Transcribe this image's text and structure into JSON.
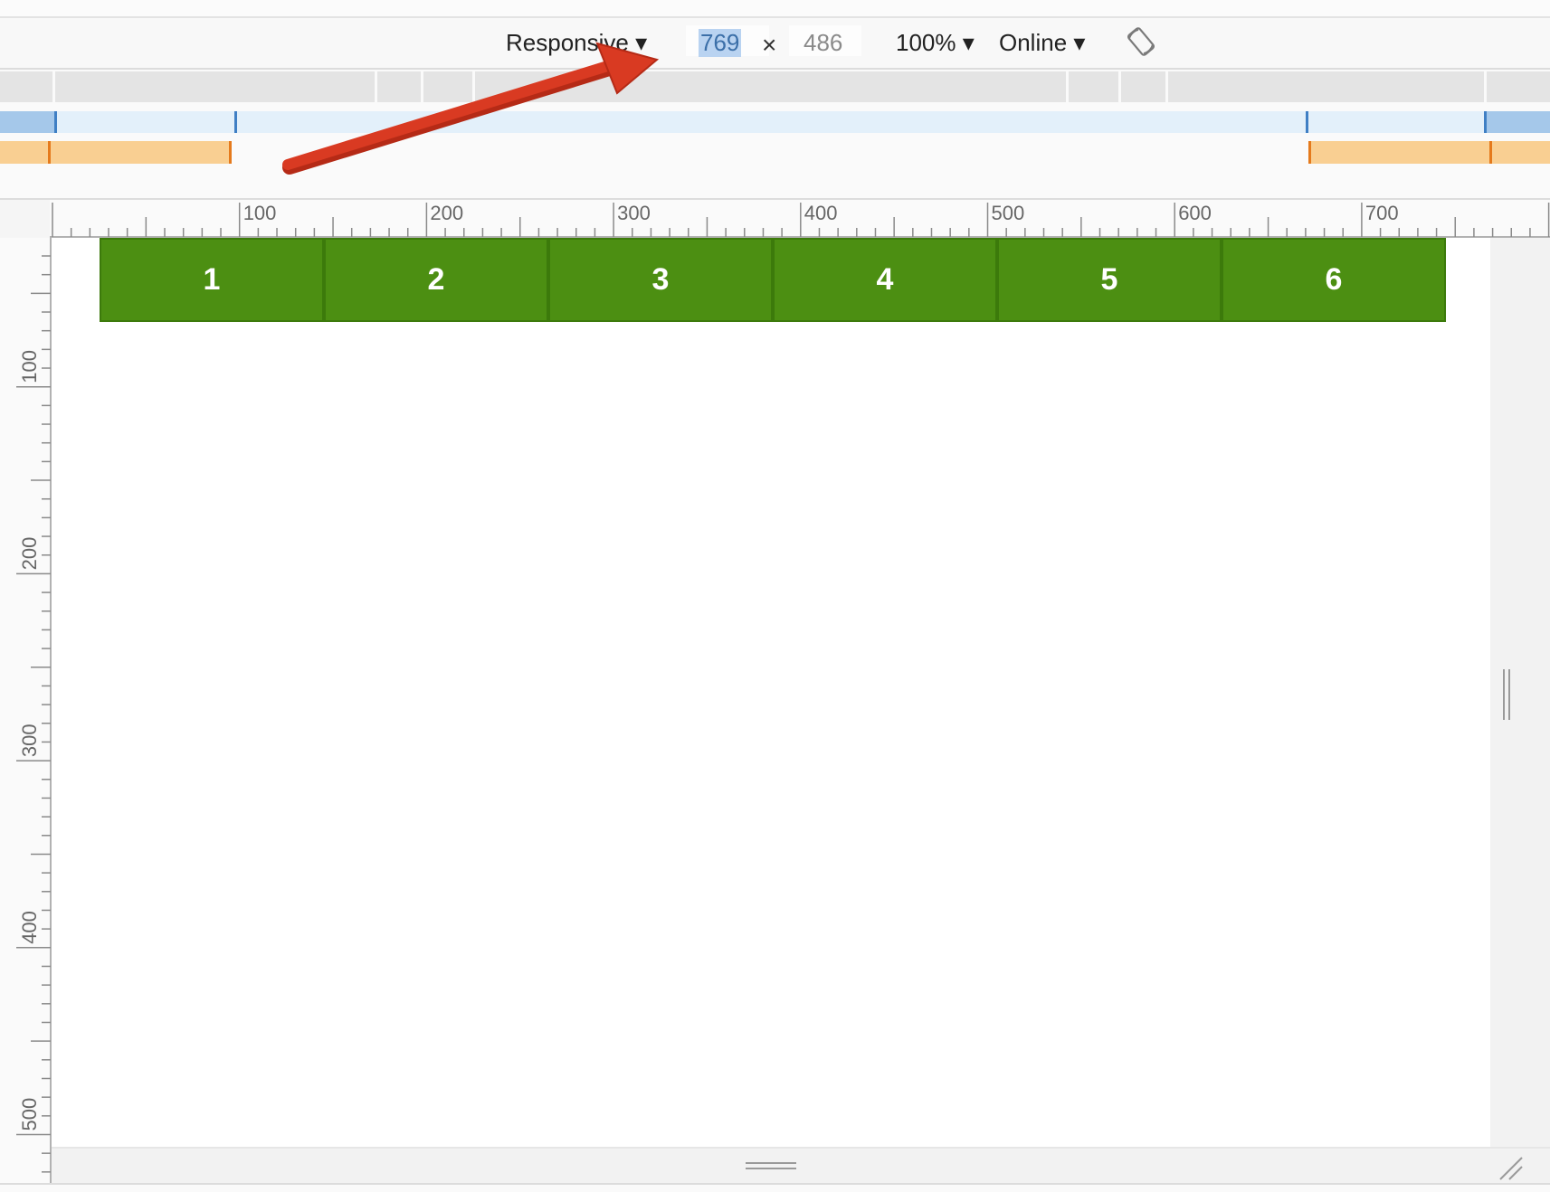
{
  "toolbar": {
    "device": "Responsive ▾",
    "width": "769",
    "times": "×",
    "height": "486",
    "zoom": "100% ▾",
    "network": "Online ▾",
    "rotate_icon": "rotate-icon"
  },
  "ruler": {
    "horizontal_labels": [
      "100",
      "200",
      "300",
      "400",
      "500",
      "600",
      "700"
    ],
    "vertical_labels": [
      "100",
      "200",
      "300",
      "400",
      "500"
    ]
  },
  "boxes": [
    "1",
    "2",
    "3",
    "4",
    "5",
    "6"
  ],
  "colors": {
    "box_green": "#4c8f12",
    "query_blue": "#a5c8ea",
    "query_orange": "#f9cf92",
    "arrow_red": "#d93a22"
  }
}
